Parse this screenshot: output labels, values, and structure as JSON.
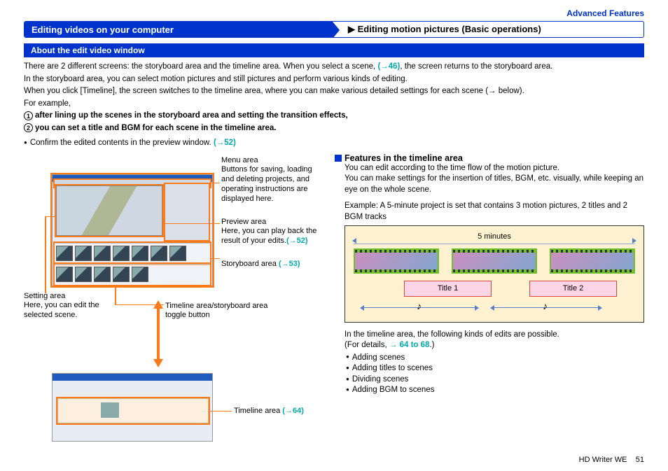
{
  "header": {
    "advanced": "Advanced Features",
    "left": "Editing videos on your computer",
    "right": "▶ Editing motion pictures (Basic operations)"
  },
  "section": "About the edit video window",
  "intro": {
    "p1a": "There are 2 different screens: the storyboard area and the timeline area. When you select a scene, ",
    "p1link": "(→46)",
    "p1b": ", the screen returns to the storyboard area.",
    "p2": "In the storyboard area, you can select motion pictures and still pictures and perform various kinds of editing.",
    "p3": "When you click [Timeline], the screen switches to the timeline area, where you can make various detailed settings for each scene (→ below).",
    "p4": "For example,",
    "n1": "after lining up the scenes in the storyboard area and setting the transition effects,",
    "n2": "you can set a title and BGM for each scene in the timeline area.",
    "confirm": "Confirm the edited contents in the preview window. ",
    "confirm_link": "(→52)"
  },
  "labels": {
    "menu_t": "Menu area",
    "menu_d": "Buttons for saving, loading and deleting projects, and operating instructions are displayed here.",
    "preview_t": "Preview area",
    "preview_d1": "Here, you can play back the result of your edits.",
    "preview_link": "(→52)",
    "story_t": "Storyboard area ",
    "story_link": "(→53)",
    "setting_t": "Setting area",
    "setting_d": "Here, you can edit the selected scene.",
    "toggle": "Timeline area/storyboard area toggle button",
    "timeline_t": "Timeline area ",
    "timeline_link": "(→64)"
  },
  "features": {
    "head": "Features in the timeline area",
    "p1": "You can edit according to the time flow of the motion picture.",
    "p2": "You can make settings for the insertion of titles, BGM, etc. visually, while keeping an eye on the whole scene.",
    "ex_label": "Example:",
    "ex_text": "A 5-minute project is set that contains 3 motion pictures, 2 titles and 2 BGM tracks",
    "five": "5 minutes",
    "title1": "Title 1",
    "title2": "Title 2",
    "post1": "In the timeline area, the following kinds of edits are possible.",
    "post2a": "(For details, ",
    "post2link": "→ 64 to 68",
    "post2b": ".)",
    "edits": [
      "Adding scenes",
      "Adding titles to scenes",
      "Dividing scenes",
      "Adding BGM to scenes"
    ]
  },
  "footer": {
    "product": "HD Writer WE",
    "page": "51"
  }
}
